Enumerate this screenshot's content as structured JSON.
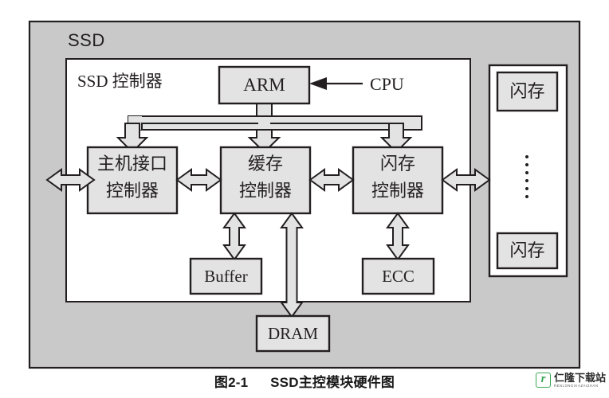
{
  "figure": {
    "outer_label": "SSD",
    "inner_label": "SSD 控制器",
    "cpu_label": "CPU",
    "caption_number": "图2-1",
    "caption_title": "SSD主控模块硬件图"
  },
  "blocks": {
    "arm": {
      "label": "ARM"
    },
    "host_interface_controller": {
      "line1": "主机接口",
      "line2": "控制器"
    },
    "cache_controller": {
      "line1": "缓存",
      "line2": "控制器"
    },
    "flash_controller": {
      "line1": "闪存",
      "line2": "控制器"
    },
    "buffer": {
      "label": "Buffer"
    },
    "ecc": {
      "label": "ECC"
    },
    "dram": {
      "label": "DRAM"
    },
    "flash_top": {
      "label": "闪存"
    },
    "flash_bottom": {
      "label": "闪存"
    },
    "flash_ellipsis": {
      "label": "⋮"
    }
  },
  "watermark": {
    "badge_letter": "r",
    "name": "仁隆下载站",
    "pinyin": "RENLONGXIAZAIZHAN",
    "accent_color": "#3aa655"
  },
  "colors": {
    "page_background": "#ffffff",
    "ssd_fill": "#c9c9c9",
    "controller_fill": "#ffffff",
    "block_fill": "#e3e3e3",
    "arrow_fill": "#e3e3e3",
    "stroke": "#231f20",
    "text": "#231f20"
  }
}
